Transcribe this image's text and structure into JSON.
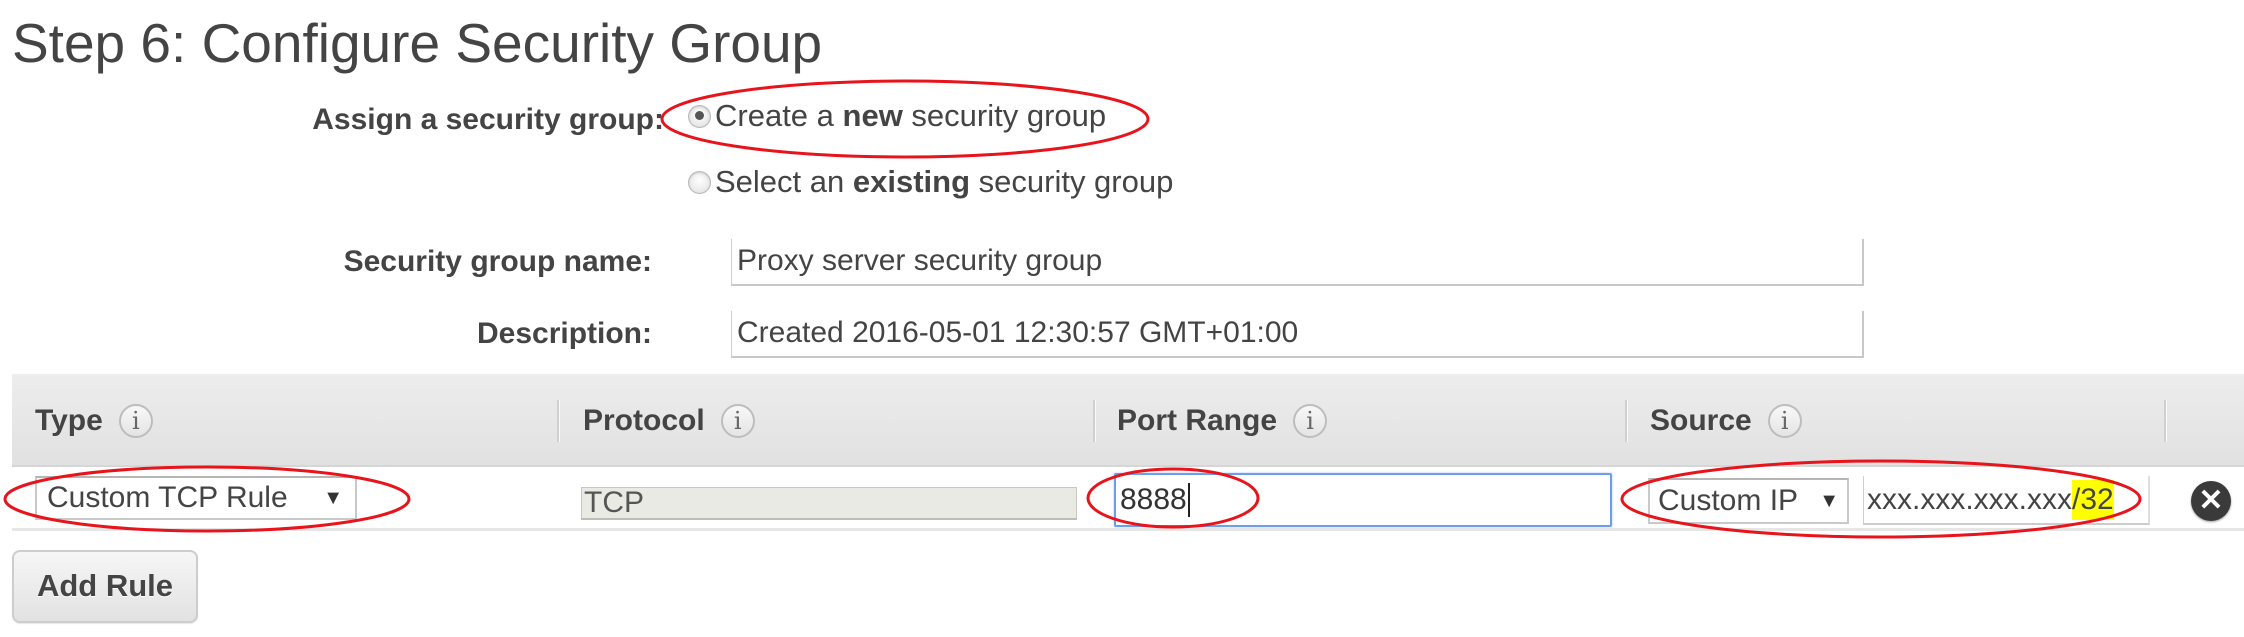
{
  "page_title": "Step 6: Configure Security Group",
  "assign": {
    "label": "Assign a security group:",
    "options": [
      {
        "prefix": "Create a ",
        "bold": "new",
        "suffix": " security group",
        "checked": true
      },
      {
        "prefix": "Select an ",
        "bold": "existing",
        "suffix": " security group",
        "checked": false
      }
    ]
  },
  "form": {
    "name_label": "Security group name:",
    "name_value": "Proxy server security group",
    "description_label": "Description:",
    "description_value": "Created 2016-05-01 12:30:57 GMT+01:00"
  },
  "table": {
    "headers": [
      {
        "label": "Type",
        "icon": "info-icon"
      },
      {
        "label": "Protocol",
        "icon": "info-icon"
      },
      {
        "label": "Port Range",
        "icon": "info-icon"
      },
      {
        "label": "Source",
        "icon": "info-icon"
      }
    ],
    "rows": [
      {
        "type": "Custom TCP Rule",
        "protocol": "TCP",
        "port_range": "8888",
        "source_type": "Custom IP",
        "source_ip_main": "xxx.xxx.xxx.xxx",
        "source_ip_cidr": "/32"
      }
    ]
  },
  "icons": {
    "info": "i",
    "caret": "▼",
    "remove": "✕"
  },
  "add_rule_label": "Add Rule",
  "colors": {
    "annotation": "#e8141c",
    "highlight": "#ffff00",
    "focus": "#6d9eeb"
  }
}
